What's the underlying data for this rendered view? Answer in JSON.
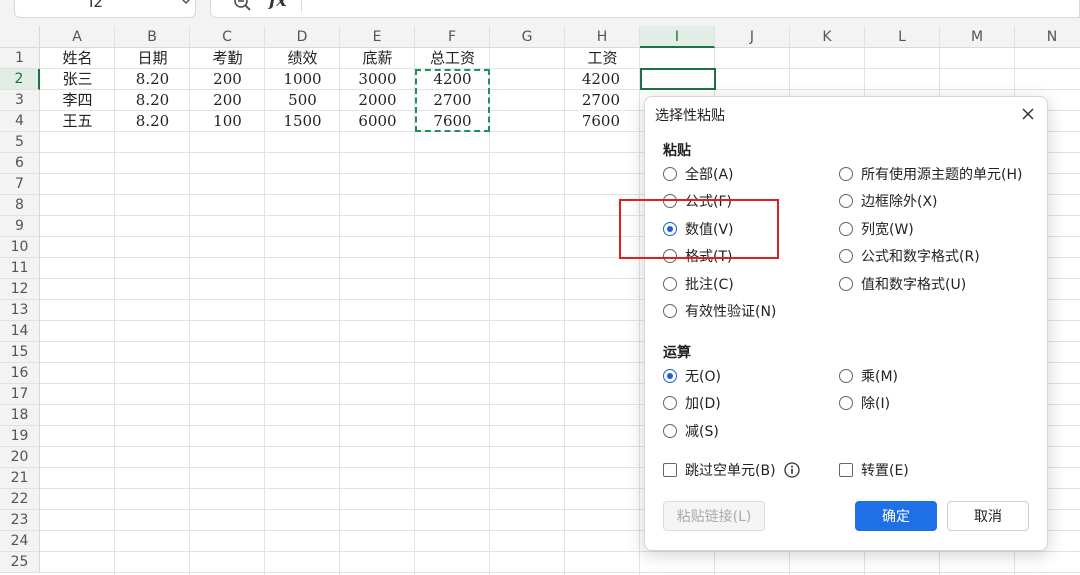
{
  "formula_bar": {
    "name_box": "I2",
    "fx": "fx"
  },
  "columns": [
    "A",
    "B",
    "C",
    "D",
    "E",
    "F",
    "G",
    "H",
    "I",
    "J",
    "K",
    "L",
    "M",
    "N"
  ],
  "selected_column": "I",
  "rows": [
    "1",
    "2",
    "3",
    "4",
    "5",
    "6",
    "7",
    "8",
    "9",
    "10",
    "11",
    "12",
    "13",
    "14",
    "15",
    "16",
    "17",
    "18",
    "19",
    "20",
    "21",
    "22",
    "23",
    "24",
    "25"
  ],
  "selected_row": "2",
  "sheet": {
    "headers": {
      "A": "姓名",
      "B": "日期",
      "C": "考勤",
      "D": "绩效",
      "E": "底薪",
      "F": "总工资",
      "H": "工资"
    },
    "data": [
      {
        "A": "张三",
        "B": "8.20",
        "C": "200",
        "D": "1000",
        "E": "3000",
        "F": "4200",
        "H": "4200"
      },
      {
        "A": "李四",
        "B": "8.20",
        "C": "200",
        "D": "500",
        "E": "2000",
        "F": "2700",
        "H": "2700"
      },
      {
        "A": "王五",
        "B": "8.20",
        "C": "100",
        "D": "1500",
        "E": "6000",
        "F": "7600",
        "H": "7600"
      }
    ]
  },
  "dialog": {
    "title": "选择性粘贴",
    "paste_section": "粘贴",
    "paste_left": [
      "全部(A)",
      "公式(F)",
      "数值(V)",
      "格式(T)",
      "批注(C)",
      "有效性验证(N)"
    ],
    "paste_right": [
      "所有使用源主题的单元(H)",
      "边框除外(X)",
      "列宽(W)",
      "公式和数字格式(R)",
      "值和数字格式(U)"
    ],
    "paste_selected": "数值(V)",
    "operation_section": "运算",
    "op_left": [
      "无(O)",
      "加(D)",
      "减(S)"
    ],
    "op_right": [
      "乘(M)",
      "除(I)"
    ],
    "op_selected": "无(O)",
    "skip_blanks": "跳过空单元(B)",
    "transpose": "转置(E)",
    "paste_link": "粘贴链接(L)",
    "ok": "确定",
    "cancel": "取消"
  },
  "colors": {
    "accent": "#1f6fe6",
    "selection": "#1e7145",
    "highlight": "#e02020"
  }
}
